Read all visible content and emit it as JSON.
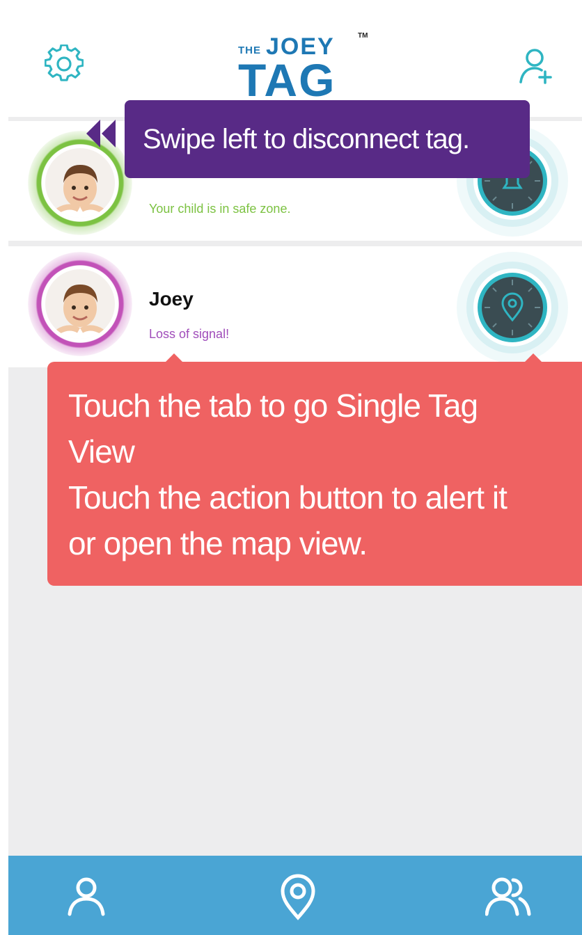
{
  "header": {
    "logo_the": "THE",
    "logo_joey": "JOEY",
    "logo_tag": "TAG",
    "logo_tm": "TM",
    "settings_icon": "gear-icon",
    "add_user_icon": "add-user-icon"
  },
  "tags": [
    {
      "name": "",
      "status": "Your child is in safe zone.",
      "status_color": "#7cc242",
      "ring_color": "#7cc242",
      "action_icon": "bell-icon"
    },
    {
      "name": "Joey",
      "status": "Loss of signal!",
      "status_color": "#a04dba",
      "ring_color": "#c252b8",
      "action_icon": "location-pin-icon"
    }
  ],
  "tooltips": {
    "swipe": "Swipe left to disconnect tag.",
    "touch_lines": [
      "Touch the tab to go Single Tag",
      "View",
      "Touch the action button to alert it",
      "or open the map view."
    ]
  },
  "bottom_nav": [
    {
      "icon": "user-icon"
    },
    {
      "icon": "map-pin-icon"
    },
    {
      "icon": "users-group-icon"
    }
  ],
  "colors": {
    "accent_teal": "#2fb5c2",
    "tooltip_purple": "#582a86",
    "tooltip_red": "#ef6262",
    "nav_blue": "#4aa5d4",
    "logo_blue": "#1e78b4"
  }
}
